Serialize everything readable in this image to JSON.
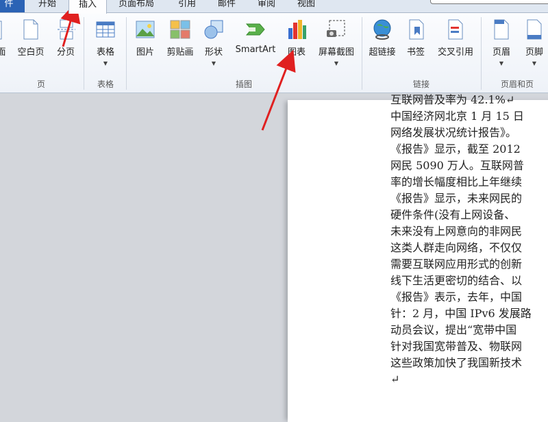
{
  "tabs": [
    {
      "label": "件",
      "name": "file"
    },
    {
      "label": "开始",
      "name": "home"
    },
    {
      "label": "插入",
      "name": "insert"
    },
    {
      "label": "页面布局",
      "name": "layout"
    },
    {
      "label": "引用",
      "name": "references"
    },
    {
      "label": "邮件",
      "name": "mail"
    },
    {
      "label": "审阅",
      "name": "review"
    },
    {
      "label": "视图",
      "name": "view"
    }
  ],
  "ribbon": {
    "pages": {
      "cover": "面",
      "blank": "空白页",
      "break": "分页",
      "group": "页"
    },
    "tables": {
      "table": "表格",
      "group": "表格"
    },
    "illustrations": {
      "picture": "图片",
      "clipart": "剪贴画",
      "shapes": "形状",
      "smartart": "SmartArt",
      "chart": "图表",
      "screenshot": "屏幕截图",
      "group": "插图"
    },
    "links": {
      "hyperlink": "超链接",
      "bookmark": "书签",
      "crossref": "交叉引用",
      "group": "链接"
    },
    "headerfooter": {
      "header": "页眉",
      "footer": "页脚",
      "group": "页眉和页"
    }
  },
  "document": {
    "lines": [
      "互联网普及率为 42.1%↵",
      "中国经济网北京 1 月 15 日",
      "网络发展状况统计报告》。",
      "《报告》显示，截至 2012",
      "网民 5090 万人。互联网普",
      "率的增长幅度相比上年继续",
      "《报告》显示，未来网民的",
      "硬件条件(没有上网设备、",
      "未来没有上网意向的非网民",
      "这类人群走向网络，不仅仅",
      "需要互联网应用形式的创新",
      "线下生活更密切的结合、以",
      "《报告》表示，去年，中国",
      "针：2 月，中国 IPv6 发展路",
      "动员会议，提出“宽带中国",
      "针对我国宽带普及、物联网",
      "这些政策加快了我国新技术",
      "↵"
    ]
  },
  "colors": {
    "accent": "#e02020",
    "file_tab": "#2b63b5"
  }
}
